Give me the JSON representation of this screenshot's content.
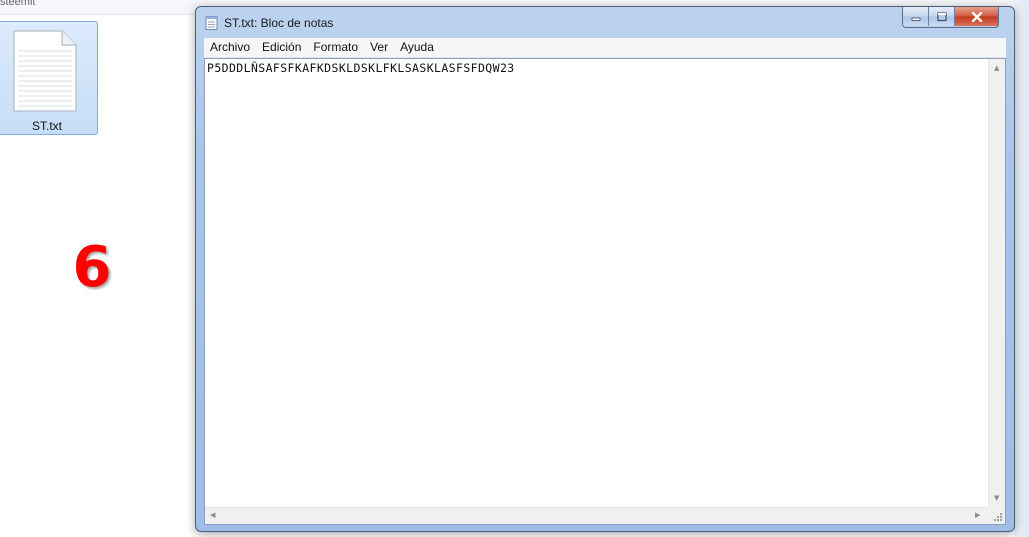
{
  "desktop": {
    "top_text": "steemit",
    "file_label": "ST.txt",
    "step_number": "6"
  },
  "window": {
    "title": "ST.txt: Bloc de notas",
    "menu": [
      "Archivo",
      "Edición",
      "Formato",
      "Ver",
      "Ayuda"
    ],
    "content": "P5DDDLÑSAFSFKAFKDSKLDSKLFKLSASKLASFSFDQW23"
  },
  "colors": {
    "step_number": "#ff0000",
    "selection": "#c6ddf7"
  }
}
